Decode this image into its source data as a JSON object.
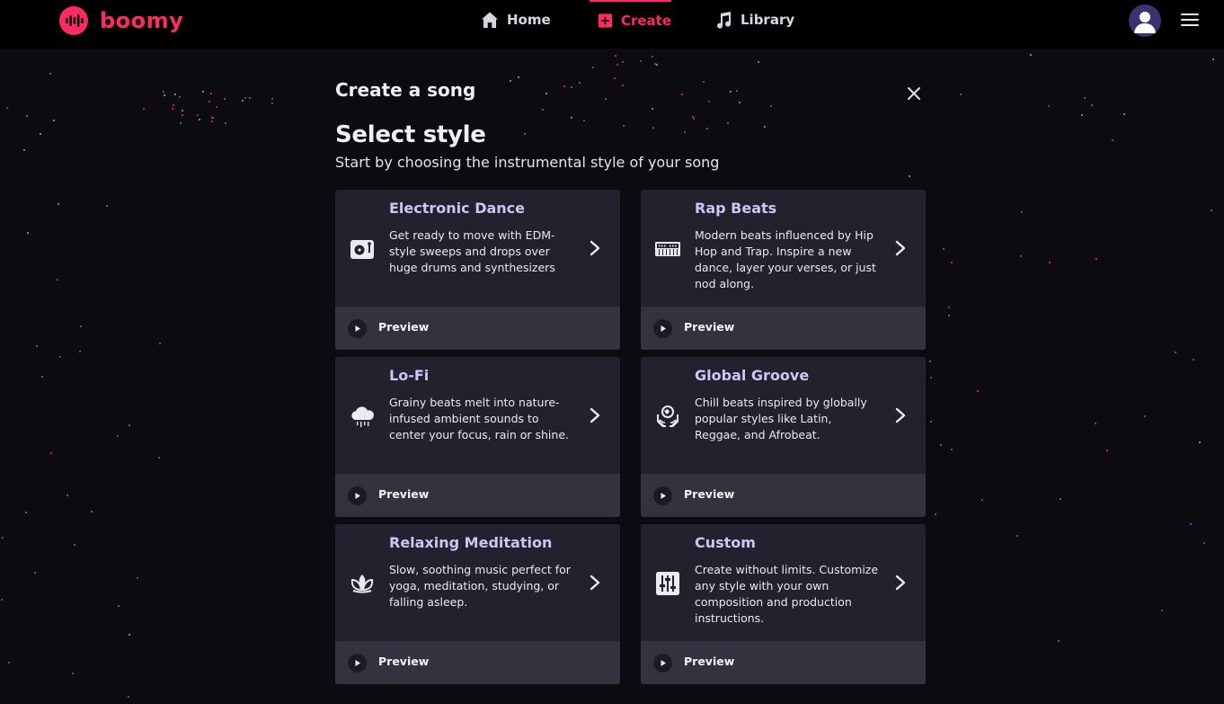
{
  "brand": {
    "name": "boomy",
    "accent": "#ff2a62"
  },
  "nav": {
    "items": [
      {
        "label": "Home",
        "icon": "home-icon"
      },
      {
        "label": "Create",
        "icon": "plus-square-icon",
        "active": true
      },
      {
        "label": "Library",
        "icon": "music-note-icon"
      }
    ]
  },
  "modal": {
    "title": "Create a song",
    "heading": "Select style",
    "subheading": "Start by choosing the instrumental style of your song"
  },
  "styles": [
    {
      "title": "Electronic Dance",
      "description": "Get ready to move with EDM-style sweeps and drops over huge drums and synthesizers",
      "icon": "turntable-icon",
      "preview": "Preview"
    },
    {
      "title": "Rap Beats",
      "description": "Modern beats influenced by Hip Hop and Trap. Inspire a new dance, layer your verses, or just nod along.",
      "icon": "keyboard-icon",
      "preview": "Preview"
    },
    {
      "title": "Lo-Fi",
      "description": "Grainy beats melt into nature-infused ambient sounds to center your focus, rain or shine.",
      "icon": "rain-cloud-icon",
      "preview": "Preview"
    },
    {
      "title": "Global Groove",
      "description": "Chill beats inspired by globally popular styles like Latin, Reggae, and Afrobeat.",
      "icon": "globe-hands-icon",
      "preview": "Preview"
    },
    {
      "title": "Relaxing Meditation",
      "description": "Slow, soothing music perfect for yoga, meditation, studying, or falling asleep.",
      "icon": "lotus-icon",
      "preview": "Preview"
    },
    {
      "title": "Custom",
      "description": "Create without limits. Customize any style with your own composition and production instructions.",
      "icon": "sliders-icon",
      "preview": "Preview"
    }
  ],
  "colors": {
    "background": "#0c0b10",
    "card": "#22212d",
    "preview_bar": "#33323f",
    "card_title": "#cdc6f5"
  }
}
